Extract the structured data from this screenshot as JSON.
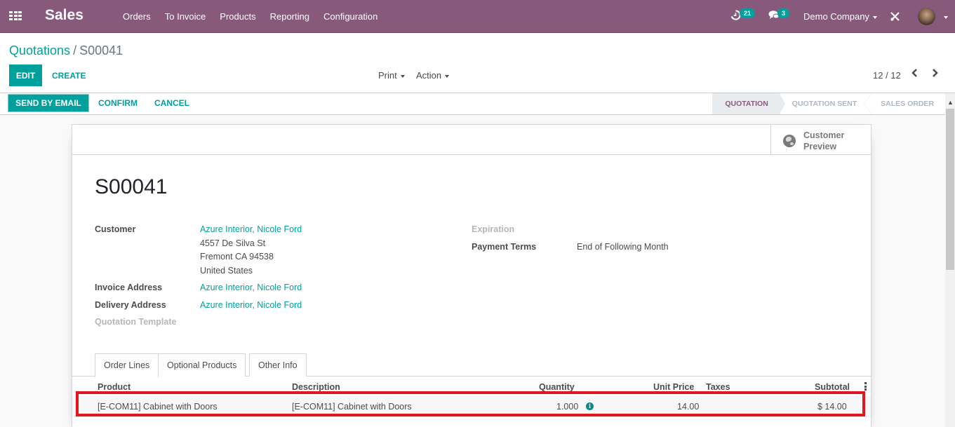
{
  "app": {
    "name": "Sales",
    "menu": [
      "Orders",
      "To Invoice",
      "Products",
      "Reporting",
      "Configuration"
    ]
  },
  "systray": {
    "activities_count": "21",
    "messages_count": "3",
    "company": "Demo Company"
  },
  "breadcrumb": {
    "parent": "Quotations",
    "separator": "/",
    "current": "S00041"
  },
  "buttons": {
    "edit": "EDIT",
    "create": "CREATE",
    "print": "Print",
    "action": "Action"
  },
  "pager": {
    "value": "12 / 12"
  },
  "header_buttons": {
    "send_by_email": "SEND BY EMAIL",
    "confirm": "CONFIRM",
    "cancel": "CANCEL"
  },
  "stages": [
    {
      "label": "QUOTATION",
      "active": true
    },
    {
      "label": "QUOTATION SENT",
      "active": false
    },
    {
      "label": "SALES ORDER",
      "active": false
    }
  ],
  "stat_button": {
    "line1": "Customer",
    "line2": "Preview"
  },
  "record": {
    "name": "S00041",
    "customer_label": "Customer",
    "customer": "Azure Interior, Nicole Ford",
    "address_line1": "4557 De Silva St",
    "address_line2": "Fremont CA 94538",
    "address_line3": "United States",
    "invoice_address_label": "Invoice Address",
    "invoice_address": "Azure Interior, Nicole Ford",
    "delivery_address_label": "Delivery Address",
    "delivery_address": "Azure Interior, Nicole Ford",
    "quotation_template_label": "Quotation Template",
    "expiration_label": "Expiration",
    "payment_terms_label": "Payment Terms",
    "payment_terms": "End of Following Month"
  },
  "tabs": [
    "Order Lines",
    "Optional Products",
    "Other Info"
  ],
  "order_lines": {
    "columns": [
      "Product",
      "Description",
      "Quantity",
      "Unit Price",
      "Taxes",
      "Subtotal"
    ],
    "rows": [
      {
        "product": "[E-COM11] Cabinet with Doors",
        "description": "[E-COM11] Cabinet with Doors",
        "quantity": "1.000",
        "unit_price": "14.00",
        "taxes": "",
        "subtotal": "$ 14.00"
      }
    ]
  },
  "colors": {
    "brand": "#875a7b",
    "accent": "#00a09d",
    "highlight": "#e4151f"
  }
}
